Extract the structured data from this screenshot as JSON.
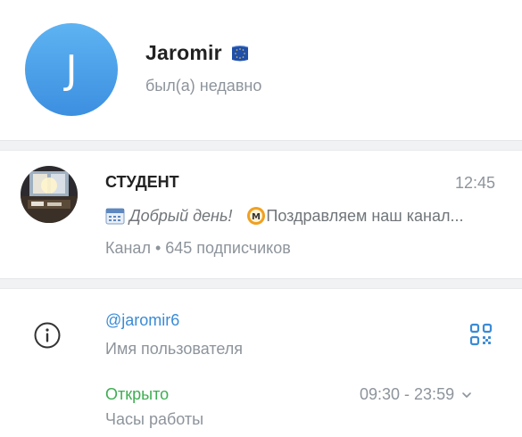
{
  "profile": {
    "avatar_letter": "J",
    "name": "Jaromir",
    "status": "был(а) недавно",
    "flag_icon": "eu-flag-icon"
  },
  "channel": {
    "title": "СТУДЕНТ",
    "time": "12:45",
    "message_greeting": "Добрый день!",
    "message_text": "Поздравляем наш канал...",
    "subscribers": "Канал • 645 подписчиков"
  },
  "info": {
    "username": "@jaromir6",
    "username_label": "Имя пользователя",
    "open_status": "Открыто",
    "hours": "09:30 - 23:59",
    "hours_label": "Часы работы"
  },
  "colors": {
    "avatar_gradient_top": "#5eb3f2",
    "avatar_gradient_bottom": "#3c8fe0",
    "link": "#3a8bd6",
    "open": "#3dae51",
    "secondary_text": "#8d949b"
  }
}
